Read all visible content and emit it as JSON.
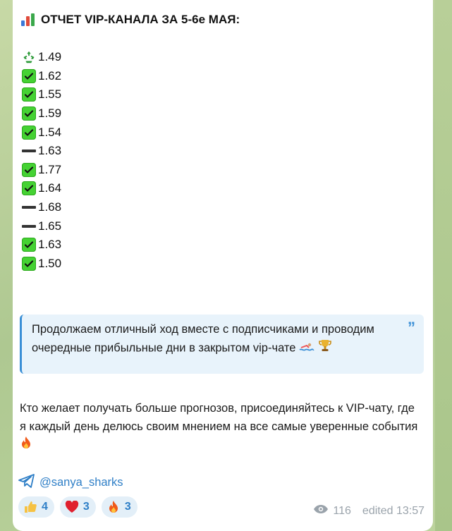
{
  "post": {
    "title": "ОТЧЕТ VIP-КАНАЛА ЗА 5-6е МАЯ:",
    "results": [
      {
        "icon": "recycle-icon",
        "value": "1.49"
      },
      {
        "icon": "check-icon",
        "value": "1.62"
      },
      {
        "icon": "check-icon",
        "value": "1.55"
      },
      {
        "icon": "check-icon",
        "value": "1.59"
      },
      {
        "icon": "check-icon",
        "value": "1.54"
      },
      {
        "icon": "dash-icon",
        "value": "1.63"
      },
      {
        "icon": "check-icon",
        "value": "1.77"
      },
      {
        "icon": "check-icon",
        "value": "1.64"
      },
      {
        "icon": "dash-icon",
        "value": "1.68"
      },
      {
        "icon": "dash-icon",
        "value": "1.65"
      },
      {
        "icon": "check-icon",
        "value": "1.63"
      },
      {
        "icon": "check-icon",
        "value": "1.50"
      }
    ],
    "quote": "Продолжаем отличный ход вместе с подписчиками и проводим очередные прибыльные дни в закрытом vip-чате",
    "paragraph": "Кто желает получать больше прогнозов, присоединяйтесь к VIP-чату, где я каждый день делюсь своим мнением на все самые уверенные события",
    "link": "@sanya_sharks"
  },
  "reactions": [
    {
      "emoji": "thumbs-up-icon",
      "count": "4"
    },
    {
      "emoji": "heart-icon",
      "count": "3"
    },
    {
      "emoji": "fire-icon",
      "count": "3"
    }
  ],
  "meta": {
    "views": "116",
    "edited": "edited 13:57"
  },
  "colors": {
    "accent": "#2f7fc7",
    "check": "#45d233",
    "quote_bg": "#e8f3fb",
    "quote_border": "#3a8fd6",
    "meta": "#9aa3ab"
  }
}
